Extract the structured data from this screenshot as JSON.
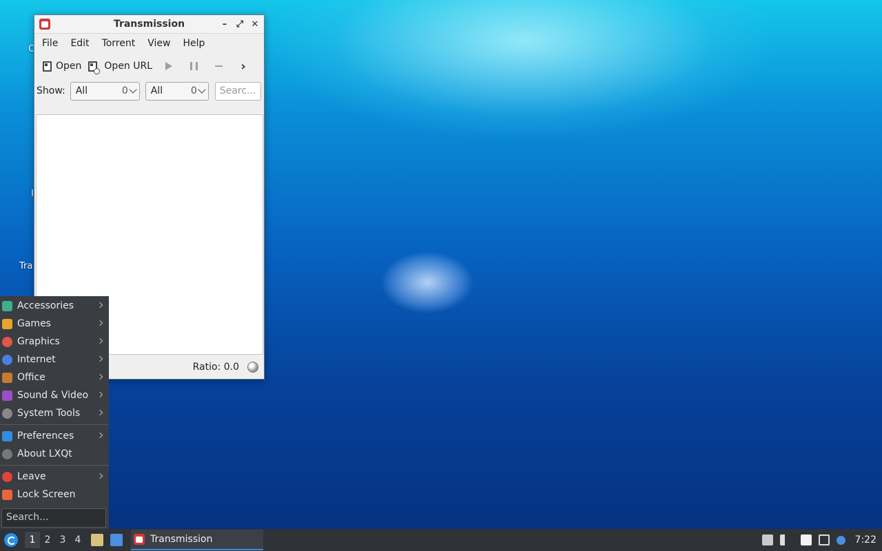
{
  "desktop": {
    "labels": [
      "C",
      "I",
      "Tra"
    ]
  },
  "window": {
    "title": "Transmission",
    "controls": {
      "minimize": "–",
      "maximize": "⤢",
      "close": "✕"
    },
    "menu": [
      "File",
      "Edit",
      "Torrent",
      "View",
      "Help"
    ],
    "toolbar": {
      "open_label": "Open",
      "open_url_label": "Open URL"
    },
    "filter": {
      "show_label": "Show:",
      "activity_select": {
        "value": "All",
        "count": "0"
      },
      "tracker_select": {
        "value": "All",
        "count": "0"
      },
      "search_placeholder": "Searc..."
    },
    "status": {
      "ratio_label": "Ratio: 0.0"
    }
  },
  "start_menu": {
    "items": [
      {
        "label": "Accessories",
        "icon": "accessories-icon",
        "color": "#3fae8e",
        "submenu": true
      },
      {
        "label": "Games",
        "icon": "games-icon",
        "color": "#e8a42c",
        "submenu": true
      },
      {
        "label": "Graphics",
        "icon": "graphics-icon",
        "color": "#e2574c",
        "submenu": true
      },
      {
        "label": "Internet",
        "icon": "internet-icon",
        "color": "#4a7fe0",
        "submenu": true
      },
      {
        "label": "Office",
        "icon": "office-icon",
        "color": "#c77a32",
        "submenu": true
      },
      {
        "label": "Sound & Video",
        "icon": "sound-video-icon",
        "color": "#9a4fc9",
        "submenu": true
      },
      {
        "label": "System Tools",
        "icon": "system-tools-icon",
        "color": "#888888",
        "submenu": true
      }
    ],
    "items2": [
      {
        "label": "Preferences",
        "icon": "preferences-icon",
        "color": "#2f8fe0",
        "submenu": true
      },
      {
        "label": "About LXQt",
        "icon": "about-icon",
        "color": "#777777",
        "submenu": false
      }
    ],
    "items3": [
      {
        "label": "Leave",
        "icon": "leave-icon",
        "color": "#e0453a",
        "submenu": true
      },
      {
        "label": "Lock Screen",
        "icon": "lock-icon",
        "color": "#e8663a",
        "submenu": false
      }
    ],
    "search_placeholder": "Search..."
  },
  "taskbar": {
    "workspaces": [
      "1",
      "2",
      "3",
      "4"
    ],
    "active_workspace": "1",
    "task_label": "Transmission",
    "clock": "7:22"
  }
}
